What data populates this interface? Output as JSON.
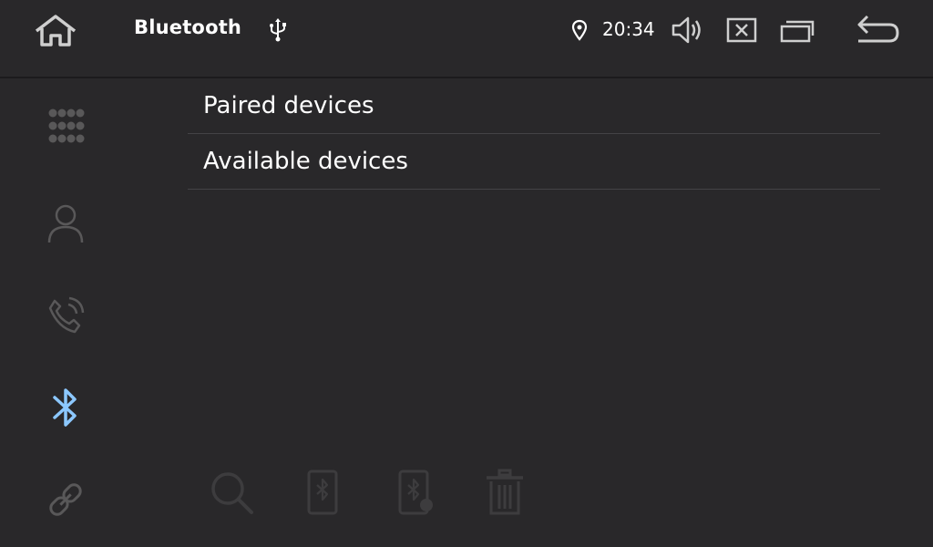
{
  "header": {
    "title": "Bluetooth",
    "time": "20:34",
    "icons": {
      "home": "home-icon",
      "usb": "usb-icon",
      "location": "location-pin-icon",
      "volume": "volume-icon",
      "close": "close-box-icon",
      "windows": "multi-window-icon",
      "back": "back-arrow-icon"
    }
  },
  "sidebar": {
    "items": [
      {
        "name": "apps",
        "icon": "dialpad-grid-icon",
        "active": false
      },
      {
        "name": "contacts",
        "icon": "person-icon",
        "active": false
      },
      {
        "name": "call-log",
        "icon": "phone-icon",
        "active": false
      },
      {
        "name": "bluetooth",
        "icon": "bluetooth-icon",
        "active": true
      },
      {
        "name": "connection",
        "icon": "link-icon",
        "active": false
      }
    ]
  },
  "main": {
    "rows": [
      {
        "label": "Paired devices"
      },
      {
        "label": "Available devices"
      }
    ]
  },
  "toolbar": {
    "icons": [
      "search-icon",
      "phone-bluetooth-icon",
      "phone-bluetooth-settings-icon",
      "trash-icon"
    ]
  },
  "colors": {
    "background": "#29282a",
    "accent": "#8cc8ff",
    "icon_dim": "#595859",
    "icon_toolbar": "#3d3c3e",
    "divider": "#444346"
  }
}
